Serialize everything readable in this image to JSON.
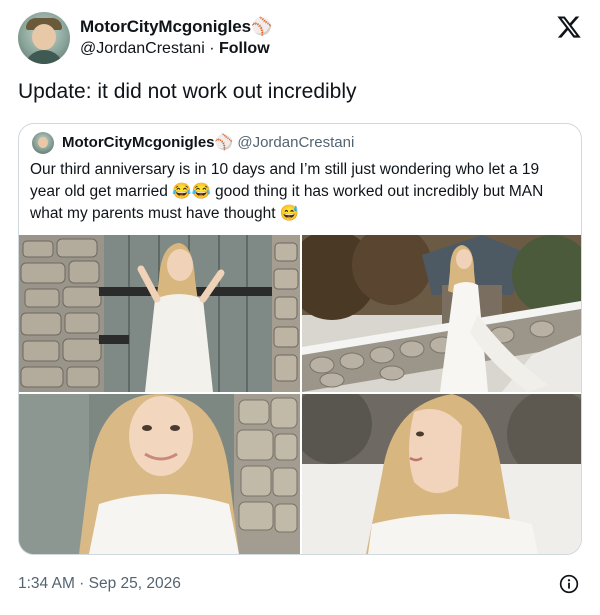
{
  "author": {
    "display_name": "MotorCityMcgonigles",
    "name_emoji": "⚾",
    "handle": "@JordanCrestani",
    "separator": "·",
    "follow_label": "Follow"
  },
  "tweet": {
    "text": "Update: it did not work out incredibly",
    "timestamp": "1:34 AM · Sep 25, 2026"
  },
  "quoted": {
    "display_name": "MotorCityMcgonigles",
    "name_emoji": "⚾",
    "handle": "@JordanCrestani",
    "text": "Our third anniversary is in 10 days and I’m still just wondering who let a 19 year old get married 😂😂 good thing it has worked out incredibly but MAN what my parents must have thought 😅"
  },
  "icons": {
    "x_logo": "x-logo-icon",
    "info": "info-icon"
  },
  "colors": {
    "text": "#0f1419",
    "secondary": "#536471",
    "border": "#cfd9de"
  }
}
